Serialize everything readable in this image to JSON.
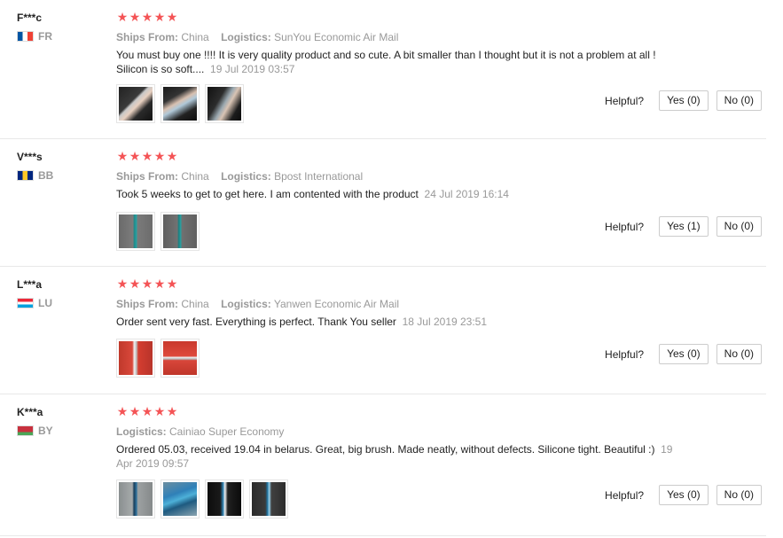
{
  "helpful_label": "Helpful?",
  "reviews": [
    {
      "user": "F***c",
      "country": "FR",
      "flag_colors": [
        "#0055a4",
        "#ffffff",
        "#ef4135"
      ],
      "stars": 5,
      "ships_from_label": "Ships From:",
      "ships_from": "China",
      "logistics_label": "Logistics:",
      "logistics": "SunYou Economic Air Mail",
      "text": "You must buy one !!!! It is very quality product and so cute. A bit smaller than I thought but it is not a problem at all ! Silicon is so soft....",
      "date": "19 Jul 2019 03:57",
      "photos": [
        "hand-pen-1",
        "hand-pen-2",
        "hand-pen-3"
      ],
      "yes": "Yes (0)",
      "no": "No (0)"
    },
    {
      "user": "V***s",
      "country": "BB",
      "flag_colors": [
        "#00267f",
        "#ffc726",
        "#00267f"
      ],
      "stars": 5,
      "ships_from_label": "Ships From:",
      "ships_from": "China",
      "logistics_label": "Logistics:",
      "logistics": "Bpost International",
      "text": "Took 5 weeks to get to get here. I am contented with the product",
      "date": "24 Jul 2019 16:14",
      "photos": [
        "pen-1",
        "pen-2"
      ],
      "yes": "Yes (1)",
      "no": "No (0)"
    },
    {
      "user": "L***a",
      "country": "LU",
      "flag_colors": [
        "#ed2939",
        "#ffffff",
        "#00a1de"
      ],
      "stars": 5,
      "ships_from_label": "Ships From:",
      "ships_from": "China",
      "logistics_label": "Logistics:",
      "logistics": "Yanwen Economic Air Mail",
      "text": "Order sent very fast. Everything is perfect. Thank You seller",
      "date": "18 Jul 2019 23:51",
      "photos": [
        "red-pen-1",
        "red-pen-2"
      ],
      "yes": "Yes (0)",
      "no": "No (0)"
    },
    {
      "user": "K***a",
      "country": "BY",
      "flag_colors": [
        "#c8313e",
        "#c8313e",
        "#4aa657"
      ],
      "stars": 5,
      "logistics_label": "Logistics:",
      "logistics": "Cainiao Super Economy",
      "text": "Ordered 05.03, received 19.04 in belarus. Great, big brush. Made neatly, without defects. Silicone tight. Beautiful :)",
      "date": "19 Apr 2019 09:57",
      "photos": [
        "blue-pen-1",
        "blue-pen-2",
        "blue-pen-3",
        "blue-pen-4"
      ],
      "yes": "Yes (0)",
      "no": "No (0)"
    }
  ]
}
